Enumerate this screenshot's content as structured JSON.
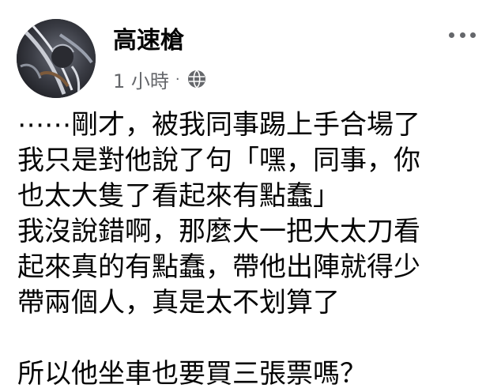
{
  "post": {
    "author": "高速槍",
    "time": "1 小時",
    "separator": "·",
    "audience_icon": "globe-icon",
    "more_icon": "more-options-icon",
    "lines": [
      "⋯⋯剛才，被我同事踢上手合場了",
      "我只是對他說了句「嘿，同事，你",
      "也太大隻了看起來有點蠢」",
      "我沒說錯啊，那麼大一把大太刀看",
      "起來真的有點蠢，帶他出陣就得少",
      "帶兩個人，真是太不划算了",
      "",
      "所以他坐車也要買三張票嗎？"
    ]
  },
  "colors": {
    "text": "#050505",
    "secondary_text": "#65676b",
    "background": "#ffffff"
  }
}
